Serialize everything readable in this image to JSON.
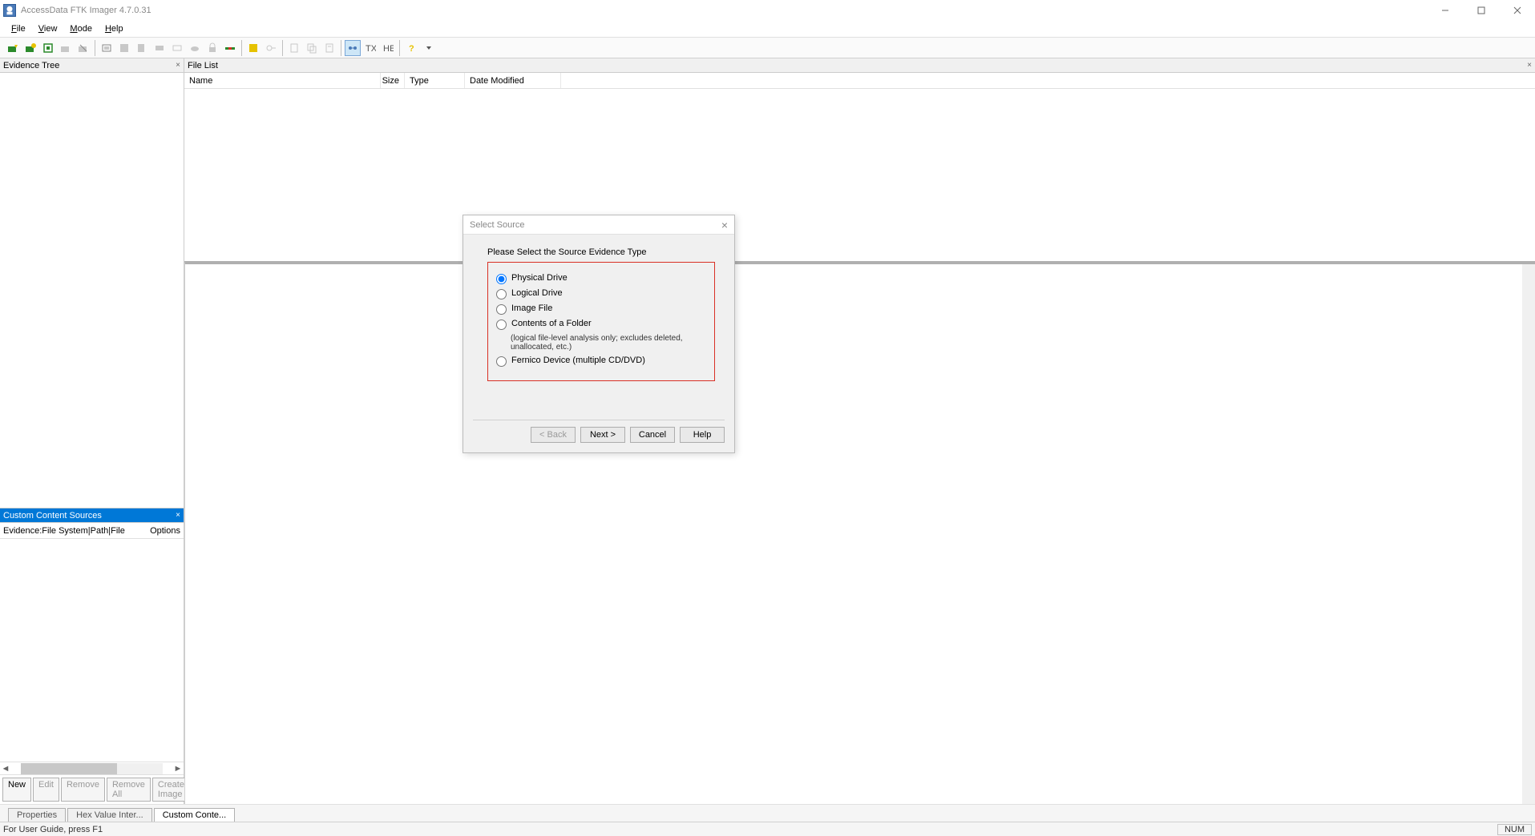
{
  "titlebar": {
    "title": "AccessData FTK Imager 4.7.0.31"
  },
  "menus": {
    "file": "File",
    "view": "View",
    "mode": "Mode",
    "help": "Help"
  },
  "panels": {
    "evidence_tree": "Evidence Tree",
    "file_list": "File List",
    "custom_content": "Custom Content Sources"
  },
  "file_list_cols": {
    "name": "Name",
    "size": "Size",
    "type": "Type",
    "date": "Date Modified"
  },
  "ccs": {
    "header_left": "Evidence:File System|Path|File",
    "header_right": "Options",
    "buttons": {
      "new": "New",
      "edit": "Edit",
      "remove": "Remove",
      "remove_all": "Remove All",
      "create_image": "Create Image"
    }
  },
  "bottom_tabs": {
    "properties": "Properties",
    "hex": "Hex Value Inter...",
    "custom": "Custom Conte..."
  },
  "statusbar": {
    "left": "For User Guide, press F1",
    "num": "NUM"
  },
  "dialog": {
    "title": "Select Source",
    "instruction": "Please Select the Source Evidence Type",
    "options": {
      "physical": "Physical Drive",
      "logical": "Logical Drive",
      "image": "Image File",
      "folder": "Contents of a Folder",
      "folder_sub": "(logical file-level analysis only; excludes deleted, unallocated, etc.)",
      "fernico": "Fernico Device (multiple CD/DVD)"
    },
    "buttons": {
      "back": "< Back",
      "next": "Next >",
      "cancel": "Cancel",
      "help": "Help"
    }
  }
}
